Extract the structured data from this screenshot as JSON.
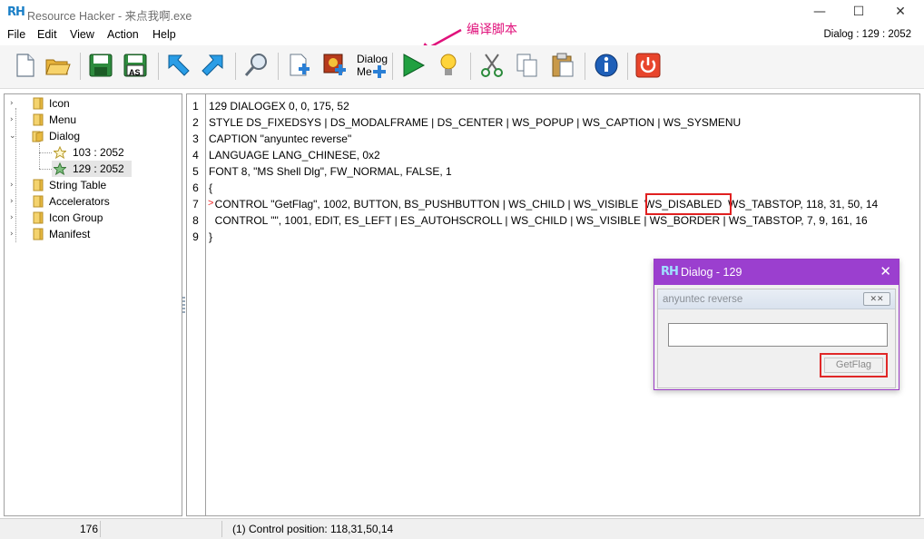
{
  "window": {
    "title": "Resource Hacker - 来点我啊.exe",
    "logo_text": "RH",
    "controls": [
      "—",
      "☐",
      "✕"
    ]
  },
  "menu": {
    "items": [
      "File",
      "Edit",
      "View",
      "Action",
      "Help"
    ],
    "dialog_info": "Dialog : 129 : 2052"
  },
  "annotation": {
    "text": "编译脚本",
    "color": "#e0117b"
  },
  "toolbar": {
    "dialog_menu_label_line1": "Dialog",
    "dialog_menu_label_line2": "Me",
    "as_label": "AS",
    "icons": [
      "new-file-icon",
      "open-folder-icon",
      "save-icon",
      "save-as-icon",
      "arrow-back-icon",
      "arrow-forward-icon",
      "find-icon",
      "add-resource-icon",
      "add-image-icon",
      "dialog-menu-icon",
      "compile-play-icon",
      "lightbulb-icon",
      "cut-icon",
      "copy-icon",
      "paste-icon",
      "info-icon",
      "power-icon"
    ]
  },
  "tree": {
    "items": [
      {
        "label": "Icon"
      },
      {
        "label": "Menu"
      },
      {
        "label": "Dialog"
      },
      {
        "label": "103 : 2052"
      },
      {
        "label": "129 : 2052"
      },
      {
        "label": "String Table"
      },
      {
        "label": "Accelerators"
      },
      {
        "label": "Icon Group"
      },
      {
        "label": "Manifest"
      }
    ]
  },
  "editor": {
    "line_numbers": [
      "1",
      "2",
      "3",
      "4",
      "5",
      "6",
      "7",
      "8",
      "9"
    ],
    "lines": [
      "129 DIALOGEX 0, 0, 175, 52",
      "STYLE DS_FIXEDSYS | DS_MODALFRAME | DS_CENTER | WS_POPUP | WS_CAPTION | WS_SYSMENU",
      "CAPTION \"anyuntec reverse\"",
      "LANGUAGE LANG_CHINESE, 0x2",
      "FONT 8, \"MS Shell Dlg\", FW_NORMAL, FALSE, 1",
      "{",
      "  CONTROL \"GetFlag\", 1002, BUTTON, BS_PUSHBUTTON | WS_CHILD | WS_VISIBLE  WS_DISABLED  WS_TABSTOP, 118, 31, 50, 14",
      "  CONTROL \"\", 1001, EDIT, ES_LEFT | ES_AUTOHSCROLL | WS_CHILD | WS_VISIBLE | WS_BORDER | WS_TABSTOP, 7, 9, 161, 16",
      "}"
    ],
    "current_line_marker": ">",
    "highlight_color": "#e02020"
  },
  "dialog_preview": {
    "title": "Dialog -  129",
    "logo_text": "RH",
    "caption": "anyuntec reverse",
    "button_label": "GetFlag",
    "close_glyph": "✕",
    "inner_close_glyph": "✕✕",
    "title_color": "#9b3fcf"
  },
  "status": {
    "left": "176",
    "message": "(1)  Control position: 118,31,50,14"
  }
}
